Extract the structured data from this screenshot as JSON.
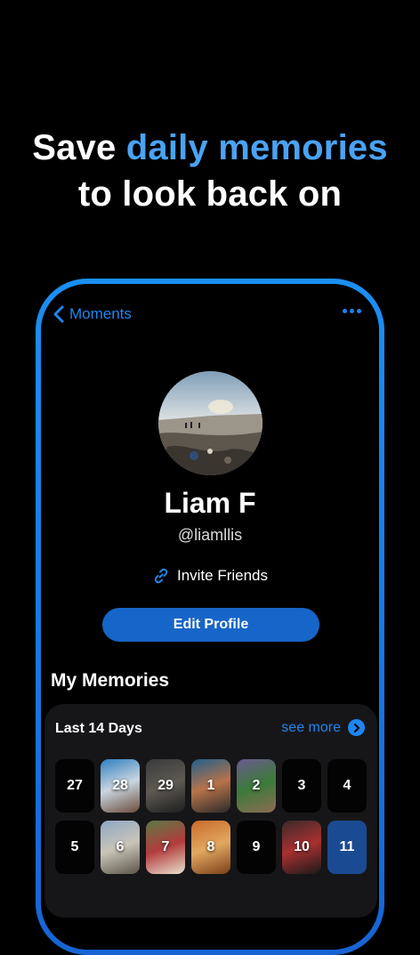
{
  "headline": {
    "prefix": "Save ",
    "accent": "daily memories",
    "line2": "to look back on"
  },
  "nav": {
    "back_label": "Moments",
    "back_icon": "chevron-left-icon",
    "more_icon": "ellipsis-icon"
  },
  "profile": {
    "name": "Liam F",
    "handle": "@liamllis",
    "invite_label": "Invite Friends",
    "invite_icon": "link-icon",
    "edit_label": "Edit Profile"
  },
  "memories": {
    "section_title": "My Memories",
    "card_title": "Last 14 Days",
    "see_more_label": "see more",
    "see_more_icon": "chevron-right-circle-icon",
    "days": [
      {
        "label": "27",
        "photo": false,
        "today": false
      },
      {
        "label": "28",
        "photo": true,
        "today": false,
        "colors": [
          "#2f7fc0",
          "#c9d6e0",
          "#6a4c3a"
        ]
      },
      {
        "label": "29",
        "photo": true,
        "today": false,
        "colors": [
          "#3a3a3c",
          "#5e5a52",
          "#1d1d1f"
        ]
      },
      {
        "label": "1",
        "photo": true,
        "today": false,
        "colors": [
          "#1e5f8a",
          "#b8734a",
          "#2a2a2a"
        ]
      },
      {
        "label": "2",
        "photo": true,
        "today": false,
        "colors": [
          "#6a5a8e",
          "#3d7a3a",
          "#8c6c52"
        ]
      },
      {
        "label": "3",
        "photo": false,
        "today": false
      },
      {
        "label": "4",
        "photo": false,
        "today": false
      },
      {
        "label": "5",
        "photo": false,
        "today": false
      },
      {
        "label": "6",
        "photo": true,
        "today": false,
        "colors": [
          "#8fa8c4",
          "#c9c4b8",
          "#5a5448"
        ]
      },
      {
        "label": "7",
        "photo": true,
        "today": false,
        "colors": [
          "#5a7a45",
          "#b33c3c",
          "#e8e2d0"
        ]
      },
      {
        "label": "8",
        "photo": true,
        "today": false,
        "colors": [
          "#c86a2a",
          "#e2a860",
          "#7a3e18"
        ]
      },
      {
        "label": "9",
        "photo": false,
        "today": false
      },
      {
        "label": "10",
        "photo": true,
        "today": false,
        "colors": [
          "#3c2a2a",
          "#a83030",
          "#1a1a1a"
        ]
      },
      {
        "label": "11",
        "photo": false,
        "today": true
      }
    ]
  },
  "colors": {
    "accent": "#4aa3f3",
    "link_blue": "#1e86f0",
    "button_blue": "#1665c8",
    "today_tile": "#1a4a92",
    "card_bg": "#161618"
  }
}
